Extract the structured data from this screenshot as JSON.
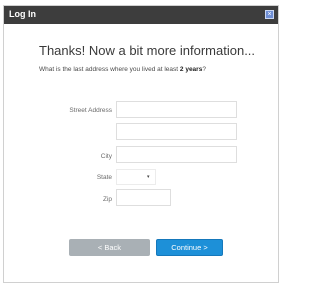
{
  "window": {
    "title": "Log In",
    "close_icon": "close-icon",
    "close_glyph": "×"
  },
  "heading": "Thanks! Now a bit more information...",
  "question": {
    "text": "What is the last address where you lived at least ",
    "emphasis": "2 years",
    "suffix": "?"
  },
  "form": {
    "street_label": "Street Address",
    "street_value": "",
    "street2_value": "",
    "city_label": "City",
    "city_value": "",
    "state_label": "State",
    "state_value": "",
    "state_caret": "▾",
    "zip_label": "Zip",
    "zip_value": ""
  },
  "buttons": {
    "back": "< Back",
    "continue": "Continue >"
  },
  "colors": {
    "titlebar": "#3d3d3d",
    "continue": "#1d90d8",
    "back": "#a9b0b5"
  }
}
